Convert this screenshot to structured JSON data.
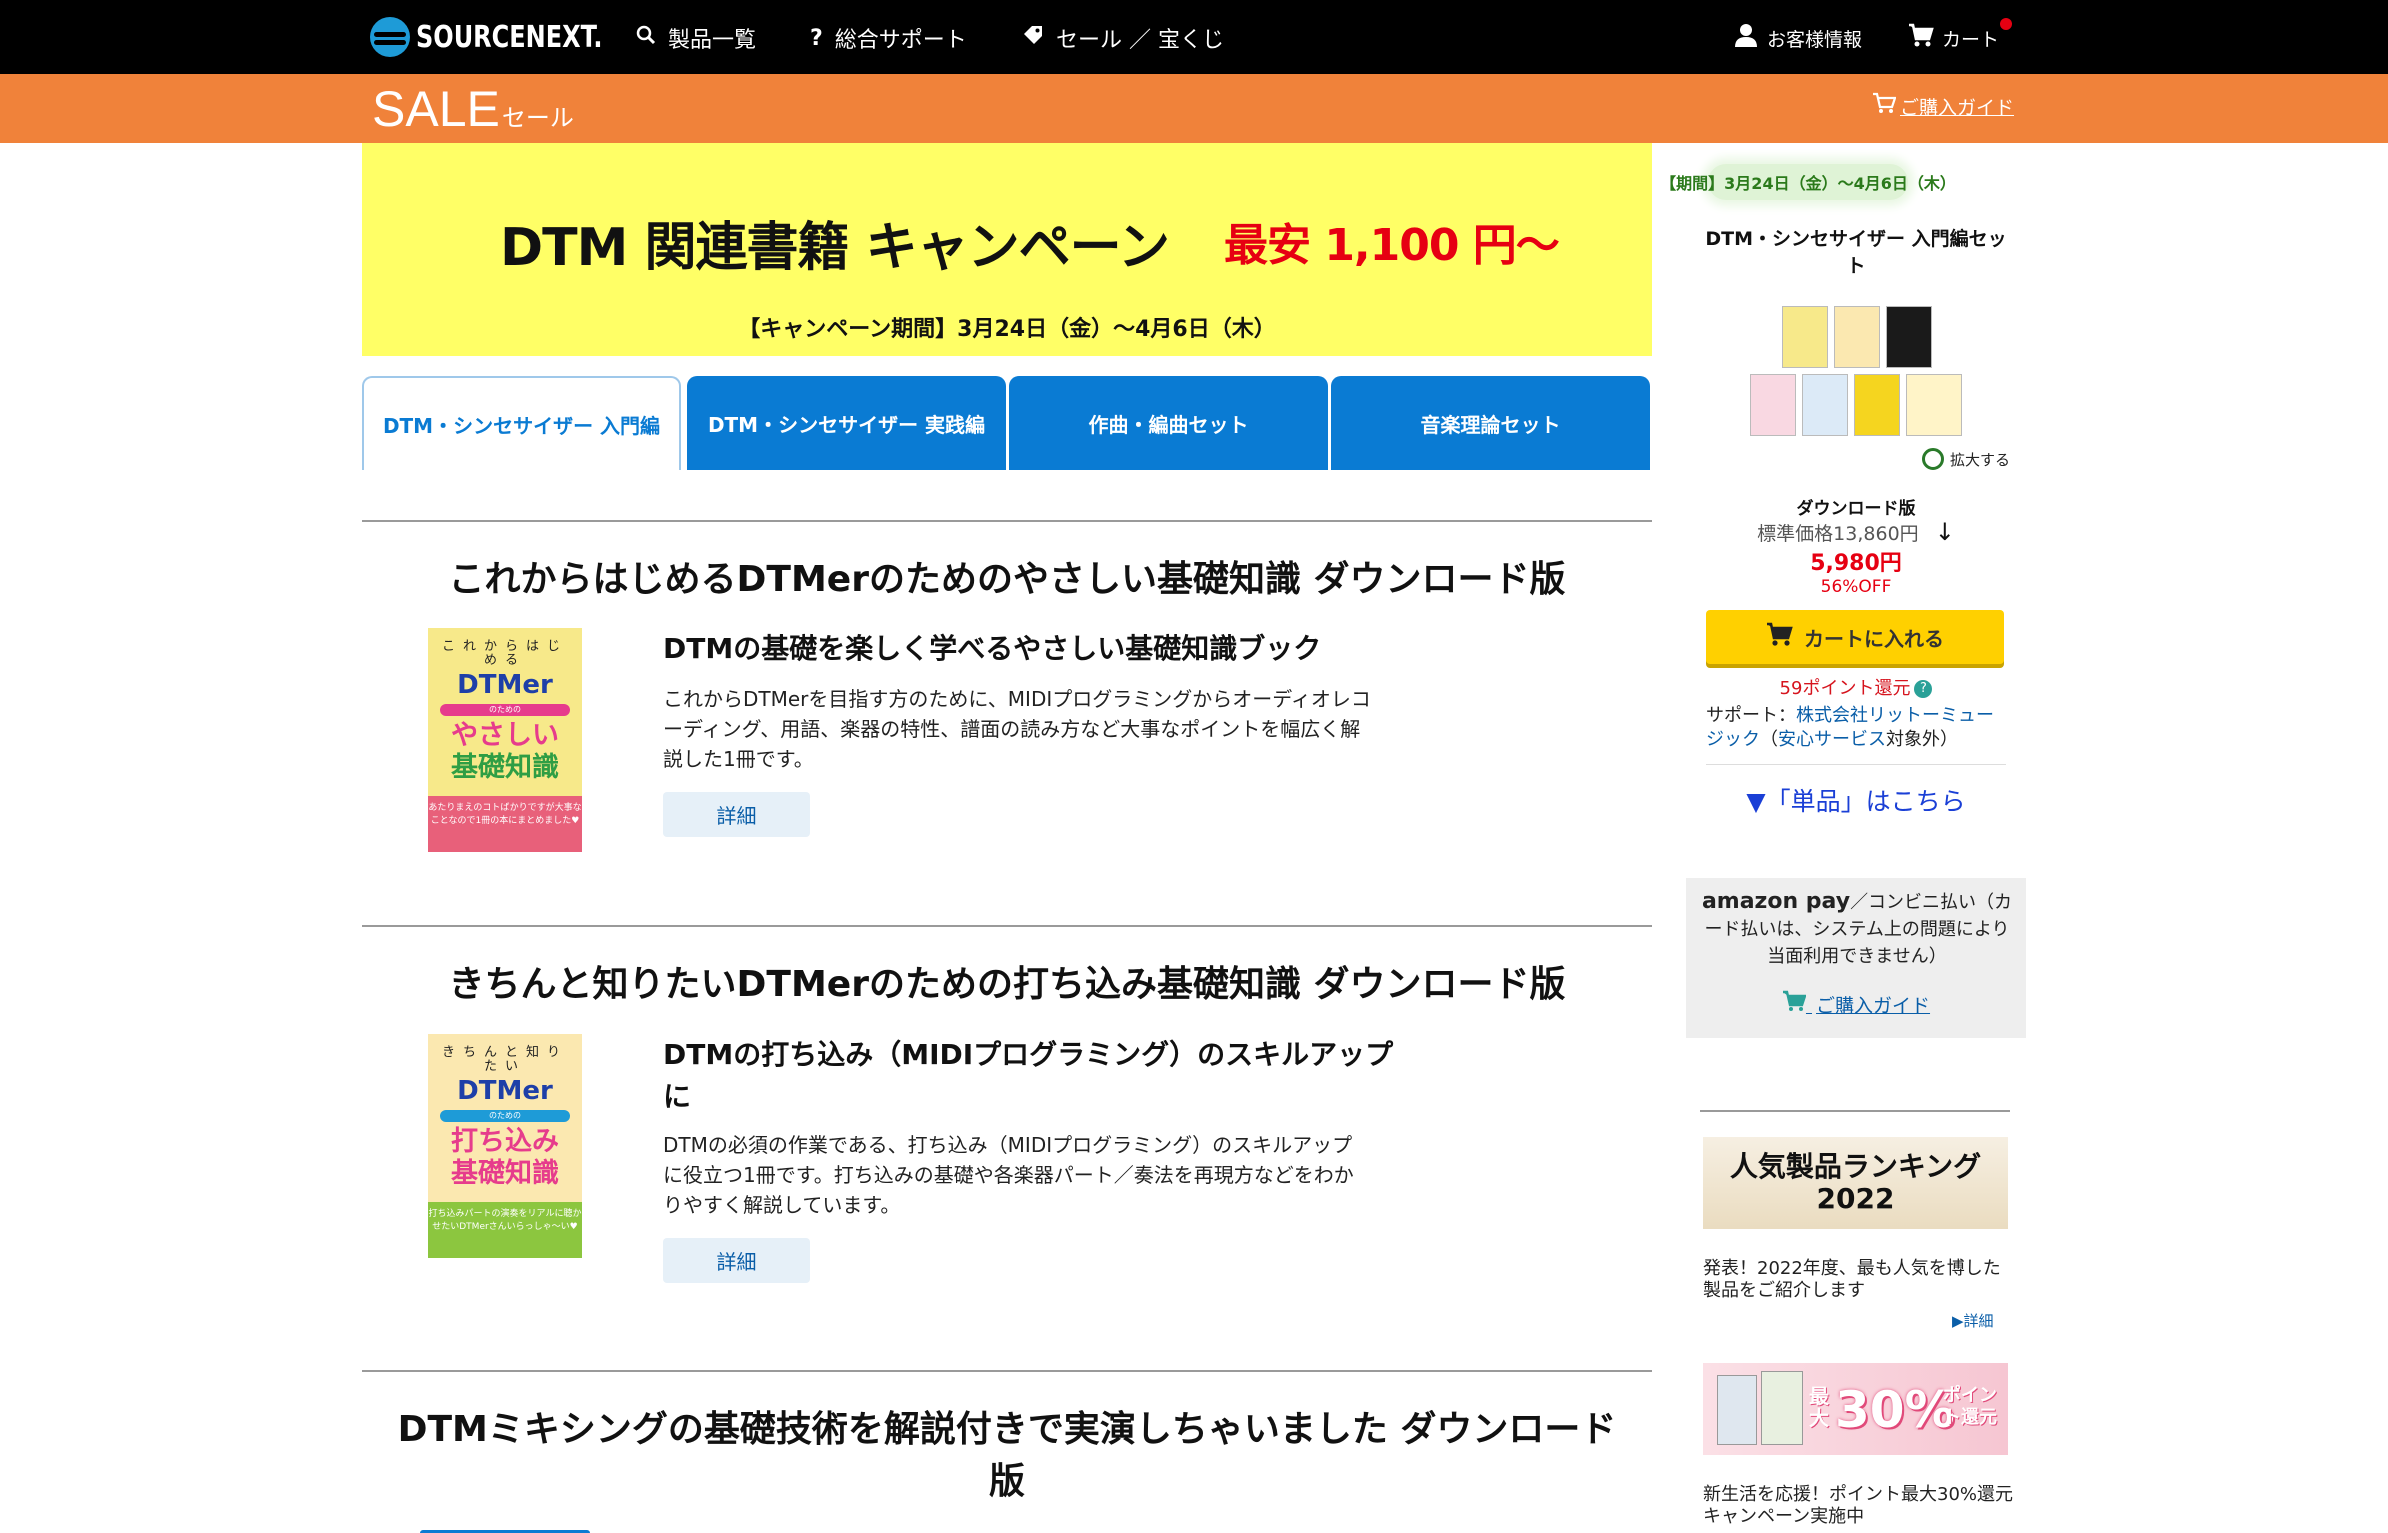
{
  "header": {
    "logo_text": "SOURCENEXT.",
    "nav": [
      {
        "label": "製品一覧",
        "icon": "search-icon"
      },
      {
        "label": "総合サポート",
        "icon": "question-icon"
      },
      {
        "label": "セール ／ 宝くじ",
        "icon": "tag-icon"
      }
    ],
    "account_label": "お客様情報",
    "cart_label": "カート"
  },
  "sale_bar": {
    "title": "SALE",
    "title_small": "セール",
    "guide_label": "ご購入ガイド"
  },
  "banner": {
    "title": "DTM 関連書籍 キャンペーン",
    "price": "最安 1,100 円〜",
    "period": "【キャンペーン期間】3月24日（金）〜4月6日（木）"
  },
  "tabs": [
    {
      "label": "DTM・シンセサイザー 入門編",
      "active": true
    },
    {
      "label": "DTM・シンセサイザー 実践編",
      "active": false
    },
    {
      "label": "作曲・編曲セット",
      "active": false
    },
    {
      "label": "音楽理論セット",
      "active": false
    }
  ],
  "products": [
    {
      "title": "これからはじめるDTMerのためのやさしい基礎知識 ダウンロード版",
      "cover": {
        "kana": "これからはじめる",
        "dtm": "DTMer",
        "band": "のための",
        "main_line1": "やさしい",
        "main_line2": "基礎知識",
        "bottom": "あたりまえのコトばかりですが大事なことなので1冊の本にまとめました♥"
      },
      "subtitle": "DTMの基礎を楽しく学べるやさしい基礎知識ブック",
      "description_lines": [
        "これからDTMerを目指す方のために、MIDIプログラミングからオーディオレコ",
        "ーディング、用語、楽器の特性、譜面の読み方など大事なポイントを幅広く解",
        "説した1冊です。"
      ],
      "detail_label": "詳細"
    },
    {
      "title": "きちんと知りたいDTMerのための打ち込み基礎知識 ダウンロード版",
      "cover": {
        "kana": "きちんと知りたい",
        "dtm": "DTMer",
        "band": "のための",
        "main_line1": "打ち込み",
        "main_line2": "基礎知識",
        "bottom": "打ち込みパートの演奏をリアルに聴かせたいDTMerさんいらっしゃ～い♥"
      },
      "subtitle_lines": [
        "DTMの打ち込み（MIDIプログラミング）のスキルアップ",
        "に"
      ],
      "description_lines": [
        "DTMの必須の作業である、打ち込み（MIDIプログラミング）のスキルアップ",
        "に役立つ1冊です。打ち込みの基礎や各楽器パート／奏法を再現方などをわか",
        "りやすく解説しています。"
      ],
      "detail_label": "詳細"
    },
    {
      "title_lines": [
        "DTMミキシングの基礎技術を解説付きで実演しちゃいました ダウンロード",
        "版"
      ]
    }
  ],
  "sidebar": {
    "period": "【期間】3月24日（金）〜4月6日（木）",
    "set_name": "DTM・シンセサイザー 入門編セット",
    "zoom_label": "拡大する",
    "edition": "ダウンロード版",
    "list_price": "標準価格13,860円",
    "arrow": "↓",
    "price": "5,980円",
    "discount": "56%OFF",
    "cart_button": "カートに入れる",
    "points": "59ポイント還元",
    "support_prefix": "サポート：",
    "support_company": "株式会社リットーミュージック",
    "support_service": "安心サービス",
    "support_suffix": "対象外",
    "single_link": "▼「単品」はこちら",
    "pay": {
      "amazon": "amazon pay",
      "text": "／コンビニ払い（カード払いは、システム上の問題により当面利用できません）",
      "guide": "ご購入ガイド"
    },
    "ranking": {
      "banner_line1": "人気製品ランキング",
      "banner_line2": "2022",
      "description": "発表！2022年度、最も人気を博した製品をご紹介します",
      "more": "詳細"
    },
    "promo": {
      "pre": "最大",
      "big": "30%",
      "post": "ポイント還元",
      "description": "新生活を応援！ポイント最大30%還元キャンペーン実施中"
    }
  },
  "colors": {
    "nav_bg": "#000000",
    "sale_bar": "#f0823a",
    "banner_bg": "#ffff66",
    "tab_blue": "#0a7bd3",
    "price_red": "#e60012",
    "cart_yellow": "#ffd000"
  }
}
